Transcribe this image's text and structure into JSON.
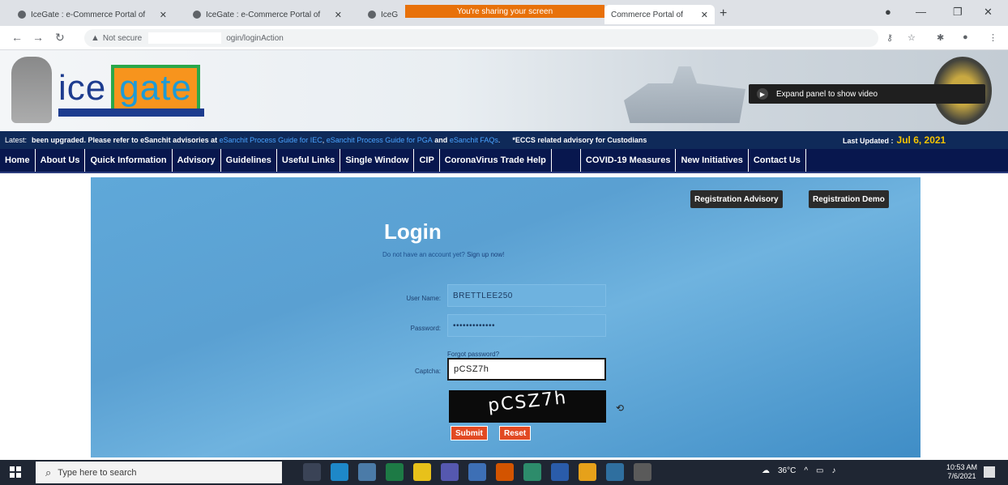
{
  "browser": {
    "tabs": [
      {
        "title": "IceGate : e-Commerce Portal of"
      },
      {
        "title": "IceGate : e-Commerce Portal of"
      },
      {
        "title": "IceG"
      },
      {
        "title": "Commerce Portal of"
      }
    ],
    "sharing_banner": "You're sharing your screen",
    "address": {
      "security": "Not secure",
      "path": "ogin/loginAction"
    }
  },
  "header": {
    "brand_ice": "ice",
    "brand_gate": "gate",
    "video_overlay": "Expand panel to show video"
  },
  "ticker": {
    "label": "Latest:",
    "message": "been upgraded. Please refer to eSanchit advisories at",
    "link_a": "eSanchit Process Guide for IEC",
    "link_b": "eSanchit Process Guide for PGA",
    "and_text": "and",
    "link_c": "eSanchit FAQs",
    "advisory": "*ECCS related advisory for Custodians",
    "updated_label": "Last Updated :",
    "updated_date": "Jul 6, 2021"
  },
  "nav": {
    "items": [
      "Home",
      "About Us",
      "Quick Information",
      "Advisory",
      "Guidelines",
      "Useful Links",
      "Single Window",
      "CIP",
      "CoronaVirus Trade Help",
      "COVID-19 Measures",
      "New Initiatives",
      "Contact Us"
    ]
  },
  "login": {
    "reg_advisory": "Registration Advisory",
    "reg_demo": "Registration Demo",
    "title": "Login",
    "signup_text": "Do not have an account yet?",
    "signup_link": "Sign up now!",
    "username_label": "User Name:",
    "username_value": "BRETTLEE250",
    "password_label": "Password:",
    "password_value": "•••••••••••••",
    "forgot": "Forgot password?",
    "captcha_label": "Captcha:",
    "captcha_value": "pCSZ7h",
    "captcha_image_text": "pCSZ7h",
    "submit": "Submit",
    "reset": "Reset"
  },
  "taskbar": {
    "search_placeholder": "Type here to search",
    "temperature": "36°C",
    "time": "10:53 AM",
    "date": "7/6/2021"
  }
}
